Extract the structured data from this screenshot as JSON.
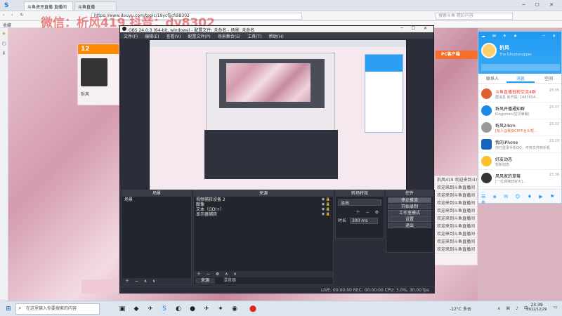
{
  "browser": {
    "tabs": [
      "斗鱼虎牙直播 直播间",
      "斗鱼直播"
    ],
    "address": "https://www.douyu.com/topic/19ycfjjcfdi8302",
    "search_placeholder": "搜索斗鱼 精彩内容",
    "bookmark": "收藏"
  },
  "watermark": {
    "line1": "微信：析风419 抖音：dy8302"
  },
  "background_page": {
    "room_label": "12",
    "streamer": "拆风",
    "right_label": "PC客户端",
    "list_rows": [
      "拆风419 欢迎来到斗鱼直播间",
      "欢迎来到斗鱼直播间",
      "欢迎来到斗鱼直播间",
      "欢迎来到斗鱼直播间",
      "欢迎来到斗鱼直播间",
      "欢迎来到斗鱼直播间",
      "欢迎来到斗鱼直播间",
      "欢迎来到斗鱼直播间",
      "欢迎来到斗鱼直播间",
      "欢迎来到斗鱼直播间"
    ]
  },
  "obs": {
    "title": "OBS 24.0.3 (64-bit, windows) - 配置文件: 未命名 - 场景: 未命名",
    "menu": [
      "文件(F)",
      "编辑(E)",
      "查看(V)",
      "配置文件(P)",
      "场景集合(S)",
      "工具(T)",
      "帮助(H)"
    ],
    "docks": {
      "scenes": {
        "title": "场景",
        "items": [
          "场景"
        ]
      },
      "sources": {
        "title": "来源",
        "items": [
          "视频捕获设备 2",
          "图像",
          "文本（GDI+）",
          "显示器捕获"
        ]
      },
      "mixer": {
        "title": "转场特效",
        "fade": "淡出",
        "duration_label": "时长",
        "duration_value": "300 ms"
      },
      "controls": {
        "title": "控件",
        "buttons": [
          "停止推流",
          "开始录制",
          "工作室模式",
          "设置",
          "退出"
        ]
      }
    },
    "dock_tabs": [
      "来源",
      "混音器"
    ],
    "status": "LIVE: 00:00:00   REC: 00:00:00   CPU: 3.0%, 30.00 fps"
  },
  "qq": {
    "nickname": "析风",
    "signature": "The Ghostshopper",
    "tabs": [
      "联系人",
      "消息",
      "空间"
    ],
    "messages": [
      {
        "name": "斗鱼直播低粉交流4群",
        "msg": "群消息 新开黑: 1487654...",
        "time": "23:35",
        "color": "#e06030"
      },
      {
        "name": "析风开播通知群",
        "msg": "Kingsman(宝贝美餐)",
        "time": "23:37",
        "color": "#1e88e5"
      },
      {
        "name": "析风24cm",
        "msg": "[有人@我]9CM平台头帮...",
        "time": "23:32",
        "color": "#999999"
      },
      {
        "name": "我的iPhone",
        "msg": "你已登录手机QQ，可传文件到手机",
        "time": "23:10",
        "color": "#1565c0"
      },
      {
        "name": "好友动态",
        "msg": "暂新动态",
        "time": "",
        "color": "#fbc02d"
      },
      {
        "name": "风风家的草莓",
        "msg": "[一位菲律宾好大]...",
        "time": "23:36",
        "color": "#333333"
      }
    ]
  },
  "taskbar": {
    "search_placeholder": "在这里输入你要搜索的内容",
    "weather": "-12°C 多云",
    "time": "23:39",
    "date": "2022/12/29"
  }
}
